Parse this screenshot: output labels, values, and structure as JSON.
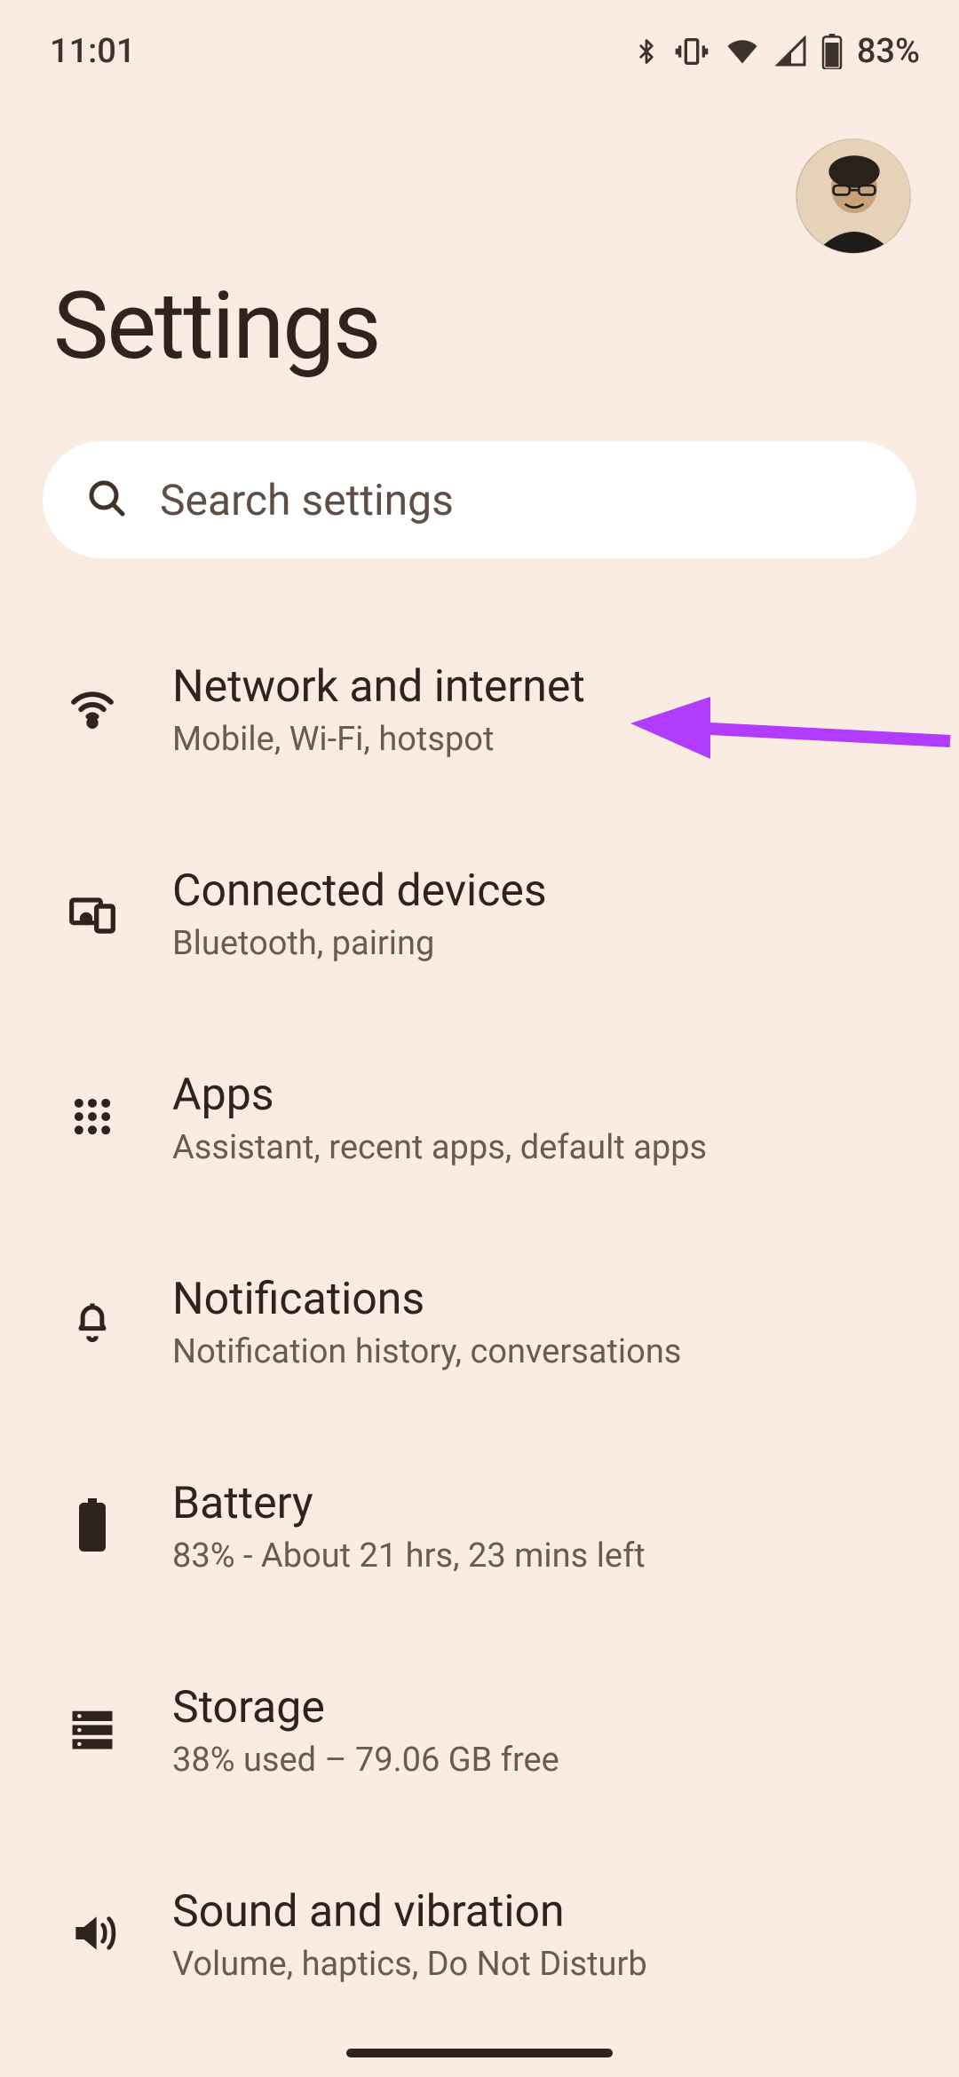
{
  "status_bar": {
    "time": "11:01",
    "battery_pct": "83%"
  },
  "header": {
    "title": "Settings"
  },
  "search": {
    "placeholder": "Search settings"
  },
  "items": [
    {
      "title": "Network and internet",
      "sub": "Mobile, Wi-Fi, hotspot"
    },
    {
      "title": "Connected devices",
      "sub": "Bluetooth, pairing"
    },
    {
      "title": "Apps",
      "sub": "Assistant, recent apps, default apps"
    },
    {
      "title": "Notifications",
      "sub": "Notification history, conversations"
    },
    {
      "title": "Battery",
      "sub": "83% - About 21 hrs, 23 mins left"
    },
    {
      "title": "Storage",
      "sub": "38% used – 79.06 GB free"
    },
    {
      "title": "Sound and vibration",
      "sub": "Volume, haptics, Do Not Disturb"
    }
  ]
}
